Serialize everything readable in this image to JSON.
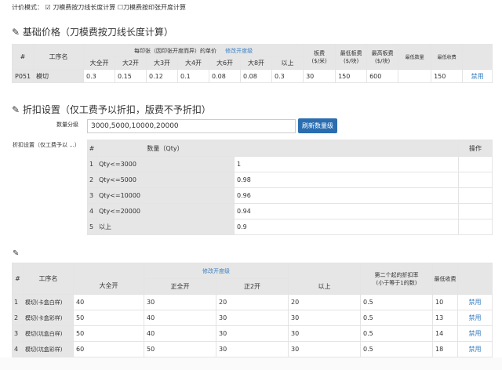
{
  "pricing_mode": {
    "label": "计价模式：",
    "option1": "刀模费按刀线长度计算",
    "option1_checked": true,
    "option2": "刀模费按印张开度计算",
    "option2_checked": false
  },
  "base": {
    "title": "基础价格（刀模费按刀线长度计算）",
    "headers": {
      "num": "#",
      "name": "工序名",
      "unit_price": "每印张（因印张开度而异）的单价",
      "modify_link": "修改开度级",
      "sizes": [
        "大全开",
        "大2开",
        "大3开",
        "大4开",
        "大6开",
        "大8开",
        "以上"
      ],
      "plate": "板费\n($/米)",
      "min_plate": "最低板费\n($/块)",
      "max_plate": "最高板费\n($/块)",
      "min_qty": "最低数量",
      "min_charge": "最低收费"
    },
    "row": {
      "num": "P051",
      "name": "模切",
      "prices": [
        "0.3",
        "0.15",
        "0.12",
        "0.1",
        "0.08",
        "0.08",
        "0.3"
      ],
      "plate": "30",
      "min_plate": "150",
      "max_plate": "600",
      "min_qty": "",
      "min_charge": "150",
      "action": "禁用"
    }
  },
  "discount": {
    "title": "折扣设置（仅工费予以折扣，版费不予折扣）",
    "qty_label": "数量分级",
    "qty_value": "3000,5000,10000,20000",
    "refresh_button": "刷新数量级",
    "table_label": "折扣设置（仅工费予以 ...）",
    "headers": {
      "num": "#",
      "qty": "数量（Qty）",
      "value": "",
      "action": "操作"
    },
    "rows": [
      {
        "num": "1",
        "qty": "Qty<=3000",
        "value": "1"
      },
      {
        "num": "2",
        "qty": "Qty<=5000",
        "value": "0.98"
      },
      {
        "num": "3",
        "qty": "Qty<=10000",
        "value": "0.96"
      },
      {
        "num": "4",
        "qty": "Qty<=20000",
        "value": "0.94"
      },
      {
        "num": "5",
        "qty": "以上",
        "value": "0.9"
      }
    ]
  },
  "process": {
    "headers": {
      "num": "#",
      "name": "工序名",
      "modify_link": "修改开度级",
      "sizes": [
        "大全开",
        "正全开",
        "正2开",
        "以上"
      ],
      "rate": "第二个起的折扣率",
      "rate_note": "(小于等于1的数)",
      "min_charge": "最低收费"
    },
    "rows": [
      {
        "num": "1",
        "name": "模切(卡盒白样)",
        "v": [
          "40",
          "30",
          "20",
          "20"
        ],
        "rate": "0.5",
        "min": "10",
        "action": "禁用"
      },
      {
        "num": "2",
        "name": "模切(卡盒彩样)",
        "v": [
          "50",
          "40",
          "30",
          "30"
        ],
        "rate": "0.5",
        "min": "13",
        "action": "禁用"
      },
      {
        "num": "3",
        "name": "模切(坑盒白样)",
        "v": [
          "50",
          "40",
          "30",
          "30"
        ],
        "rate": "0.5",
        "min": "14",
        "action": "禁用"
      },
      {
        "num": "4",
        "name": "模切(坑盒彩样)",
        "v": [
          "60",
          "50",
          "30",
          "30"
        ],
        "rate": "0.5",
        "min": "18",
        "action": "禁用"
      }
    ]
  }
}
